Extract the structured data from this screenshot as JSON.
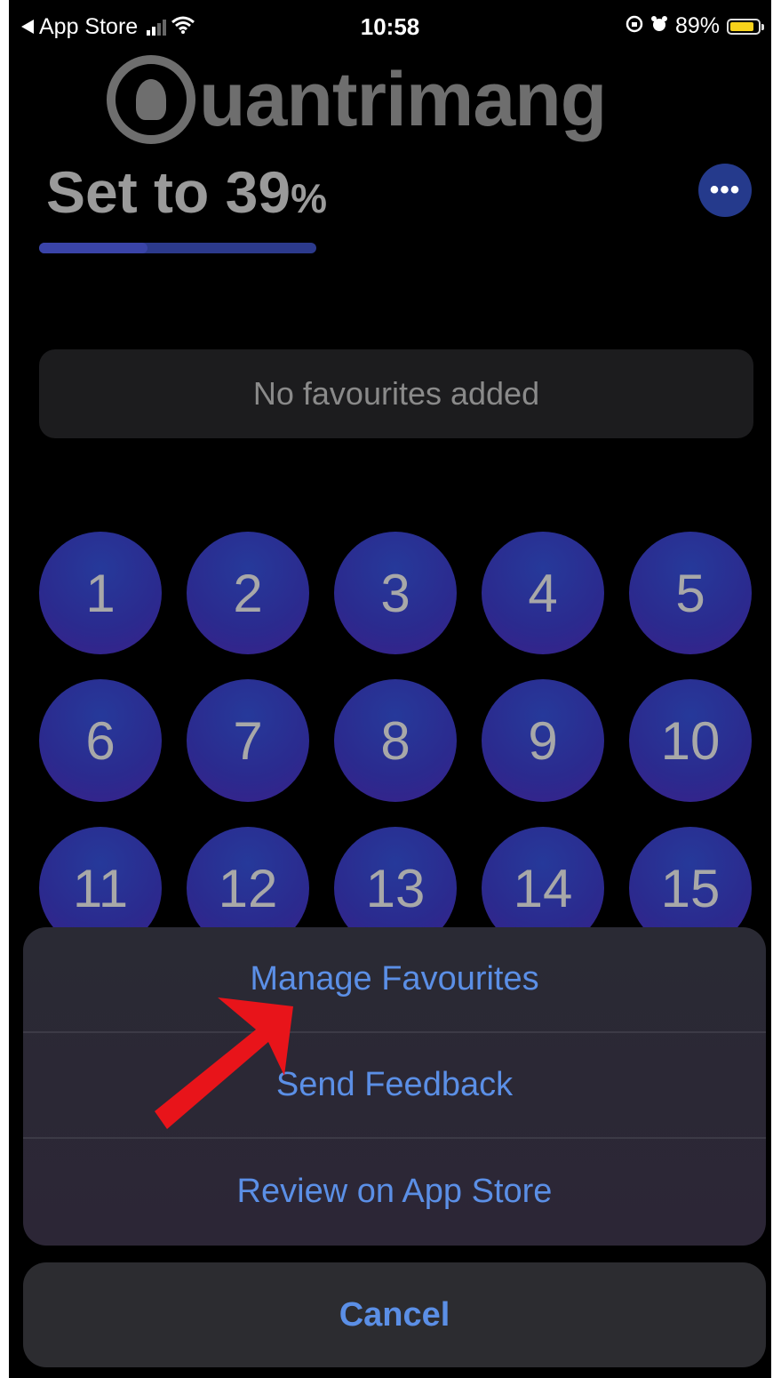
{
  "status_bar": {
    "back_app": "App Store",
    "time": "10:58",
    "battery_percent": "89%",
    "battery_level": 0.89,
    "signal_bars_on": 2,
    "signal_bars_total": 4
  },
  "watermark": {
    "brand": "uantrimang"
  },
  "header": {
    "title_prefix": "Set to 39",
    "title_unit": "%",
    "more_label": "•••",
    "progress": 0.39
  },
  "favourites": {
    "empty_text": "No favourites added"
  },
  "number_grid": [
    "1",
    "2",
    "3",
    "4",
    "5",
    "6",
    "7",
    "8",
    "9",
    "10",
    "11",
    "12",
    "13",
    "14",
    "15"
  ],
  "action_sheet": {
    "items": [
      {
        "label": "Manage Favourites"
      },
      {
        "label": "Send Feedback"
      },
      {
        "label": "Review on App Store"
      }
    ],
    "cancel_label": "Cancel"
  },
  "colors": {
    "accent_blue": "#5b8fe6",
    "circle_blue": "#2b2a8e",
    "arrow_red": "#e8141a"
  },
  "icons": [
    "back-triangle-icon",
    "signal-icon",
    "wifi-icon",
    "orientation-lock-icon",
    "alarm-icon",
    "battery-icon",
    "ellipsis-icon",
    "arrow-annotation-icon"
  ]
}
